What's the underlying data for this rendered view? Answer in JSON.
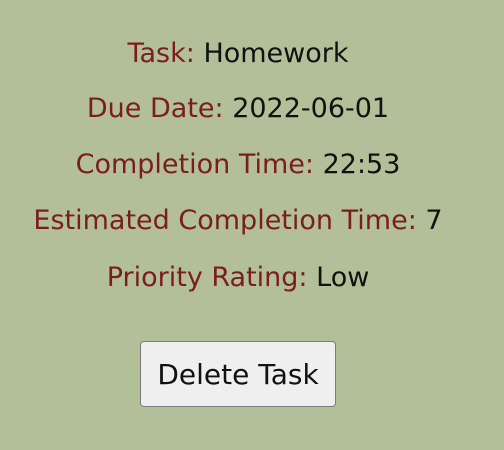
{
  "task_details": {
    "task": {
      "label": "Task:",
      "value": "Homework"
    },
    "due_date": {
      "label": "Due Date:",
      "value": "2022-06-01"
    },
    "completion_time": {
      "label": "Completion Time:",
      "value": "22:53"
    },
    "estimated_completion_time": {
      "label": "Estimated Completion Time:",
      "value": "7"
    },
    "priority_rating": {
      "label": "Priority Rating:",
      "value": "Low"
    }
  },
  "actions": {
    "delete_label": "Delete Task"
  },
  "colors": {
    "background": "#b2bf98",
    "label": "#7b1d1d",
    "value": "#111111",
    "button_background": "#efefef",
    "button_border": "#7d7d7d"
  }
}
